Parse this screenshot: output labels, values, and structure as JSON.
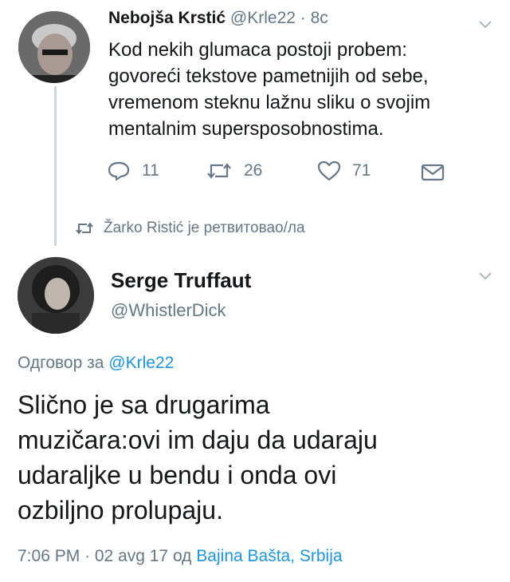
{
  "first_tweet": {
    "author_name": "Nebojša Krstić",
    "handle": "@Krle22",
    "time": "· 8с",
    "text_lines": [
      "Kod nekih glumaca postoji probem:",
      "govoreći tekstove pametnijih od sebe,",
      "vremenom steknu lažnu sliku o svojim",
      "mentalnim supersposobnostima."
    ],
    "replies": "11",
    "retweets": "26",
    "likes": "71"
  },
  "retweet_notice": "Žarko Ristić је ретвитовао/ла",
  "main_tweet": {
    "author_name": "Serge Truffaut",
    "handle": "@WhistlerDick",
    "reply_prefix": "Одговор за",
    "reply_to": "@Krle22",
    "text_lines": [
      "Slično je sa drugarima",
      "muzičara:ovi im daju da udaraju",
      "udaraljke u bendu i onda ovi",
      "ozbiljno prolupaju."
    ],
    "timestamp": "7:06 PM · 02 avg 17",
    "from_label": "од",
    "location": "Bajina Bašta, Srbija"
  },
  "colors": {
    "text": "#14171a",
    "muted": "#657786",
    "link": "#1b95e0",
    "line": "#ccd6dd"
  },
  "icons": [
    "chevron-down-icon",
    "reply-icon",
    "retweet-icon",
    "like-icon",
    "message-icon",
    "retweet-small-icon"
  ]
}
